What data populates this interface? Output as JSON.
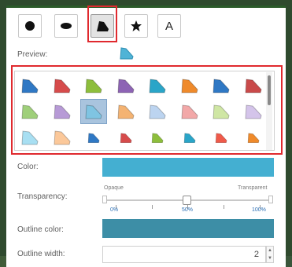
{
  "symbol_types": [
    {
      "name": "circle"
    },
    {
      "name": "ellipse"
    },
    {
      "name": "custom-shape"
    },
    {
      "name": "star"
    },
    {
      "name": "text",
      "label": "A"
    }
  ],
  "preview": {
    "label": "Preview:",
    "color": "#4fb3d6"
  },
  "palette": [
    [
      "#2f78c4",
      "#d64b4b",
      "#8dbe3c",
      "#8d63b4",
      "#2aa5c8",
      "#ef8a2b",
      "#2f78c4",
      "#c94a4a"
    ],
    [
      "#9fcf7a",
      "#b79ad6",
      "#7fc4e2",
      "#f4b372",
      "#bcd4f0",
      "#f2a8a8",
      "#cfe6a4",
      "#d4c4ea"
    ],
    [
      "#a8dff2",
      "#fbc89a",
      "#2f78c4",
      "#d64b4b",
      "#8dbe3c",
      "#2aa5c8",
      "#ef5a4a",
      "#ef8a2b"
    ]
  ],
  "color_field": {
    "label": "Color:",
    "value": "#44afd1"
  },
  "transparency": {
    "label": "Transparency:",
    "opaque_label": "Opaque",
    "transparent_label": "Transparent",
    "ticks": [
      "0%",
      "50%",
      "100%"
    ],
    "value_percent": 50
  },
  "outline_color": {
    "label": "Outline color:",
    "value": "#3d8ea6"
  },
  "outline_width": {
    "label": "Outline width:",
    "value": "2"
  },
  "spinner": {
    "up": "▲",
    "down": "▼"
  }
}
